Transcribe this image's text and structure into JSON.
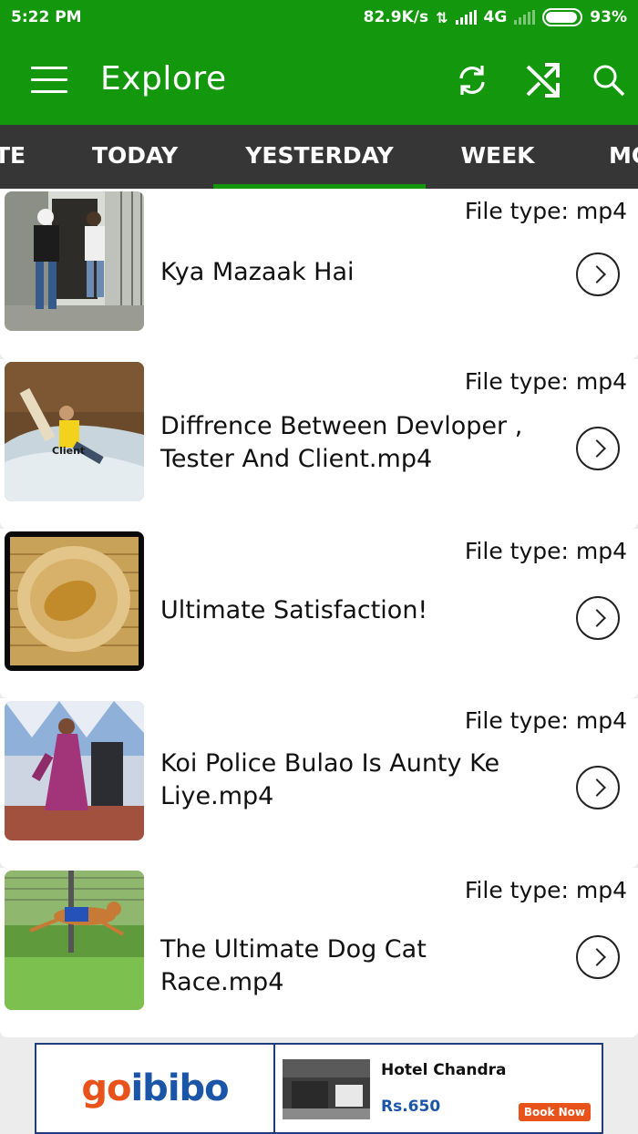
{
  "status_bar": {
    "time": "5:22 PM",
    "speed": "82.9K/s",
    "network": "4G",
    "battery": "93%"
  },
  "app_bar": {
    "title": "Explore",
    "icons": [
      "menu-icon",
      "refresh-icon",
      "shuffle-icon",
      "search-icon"
    ]
  },
  "tabs": [
    {
      "label": "TE"
    },
    {
      "label": "TODAY"
    },
    {
      "label": "YESTERDAY",
      "active": true
    },
    {
      "label": "WEEK"
    },
    {
      "label": "MO"
    }
  ],
  "items": [
    {
      "file_type": "File type: mp4",
      "title": "Kya Mazaak Hai"
    },
    {
      "file_type": "File type: mp4",
      "title": "Diffrence Between Devloper , Tester And Client.mp4",
      "thumb_label": "Client"
    },
    {
      "file_type": "File type: mp4",
      "title": "Ultimate Satisfaction!"
    },
    {
      "file_type": "File type: mp4",
      "title": "Koi Police Bulao Is Aunty Ke Liye.mp4"
    },
    {
      "file_type": "File type: mp4",
      "title": "The Ultimate Dog Cat Race.mp4"
    }
  ],
  "ad": {
    "logo_a": "go",
    "logo_b": "ibibo",
    "hotel_name": "Hotel Chandra",
    "price": "Rs.650",
    "cta": "Book Now"
  },
  "colors": {
    "primary": "#13980d",
    "tab_bar": "#363636",
    "accent": "#e8521b",
    "link_blue": "#1b55a8"
  }
}
